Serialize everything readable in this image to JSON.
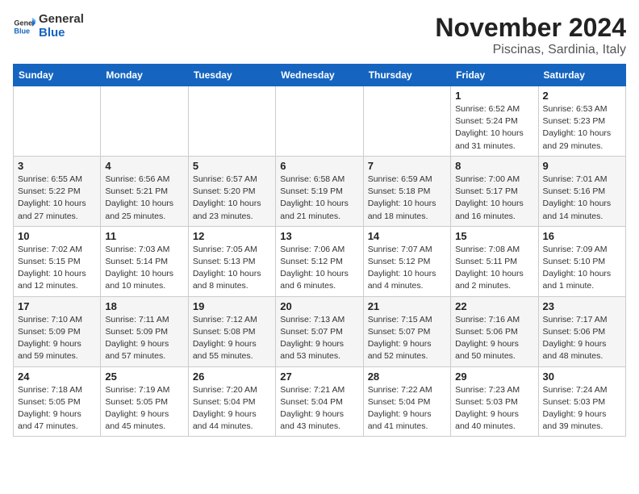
{
  "logo": {
    "general": "General",
    "blue": "Blue"
  },
  "header": {
    "month": "November 2024",
    "location": "Piscinas, Sardinia, Italy"
  },
  "weekdays": [
    "Sunday",
    "Monday",
    "Tuesday",
    "Wednesday",
    "Thursday",
    "Friday",
    "Saturday"
  ],
  "weeks": [
    [
      {
        "day": "",
        "detail": ""
      },
      {
        "day": "",
        "detail": ""
      },
      {
        "day": "",
        "detail": ""
      },
      {
        "day": "",
        "detail": ""
      },
      {
        "day": "",
        "detail": ""
      },
      {
        "day": "1",
        "detail": "Sunrise: 6:52 AM\nSunset: 5:24 PM\nDaylight: 10 hours and 31 minutes."
      },
      {
        "day": "2",
        "detail": "Sunrise: 6:53 AM\nSunset: 5:23 PM\nDaylight: 10 hours and 29 minutes."
      }
    ],
    [
      {
        "day": "3",
        "detail": "Sunrise: 6:55 AM\nSunset: 5:22 PM\nDaylight: 10 hours and 27 minutes."
      },
      {
        "day": "4",
        "detail": "Sunrise: 6:56 AM\nSunset: 5:21 PM\nDaylight: 10 hours and 25 minutes."
      },
      {
        "day": "5",
        "detail": "Sunrise: 6:57 AM\nSunset: 5:20 PM\nDaylight: 10 hours and 23 minutes."
      },
      {
        "day": "6",
        "detail": "Sunrise: 6:58 AM\nSunset: 5:19 PM\nDaylight: 10 hours and 21 minutes."
      },
      {
        "day": "7",
        "detail": "Sunrise: 6:59 AM\nSunset: 5:18 PM\nDaylight: 10 hours and 18 minutes."
      },
      {
        "day": "8",
        "detail": "Sunrise: 7:00 AM\nSunset: 5:17 PM\nDaylight: 10 hours and 16 minutes."
      },
      {
        "day": "9",
        "detail": "Sunrise: 7:01 AM\nSunset: 5:16 PM\nDaylight: 10 hours and 14 minutes."
      }
    ],
    [
      {
        "day": "10",
        "detail": "Sunrise: 7:02 AM\nSunset: 5:15 PM\nDaylight: 10 hours and 12 minutes."
      },
      {
        "day": "11",
        "detail": "Sunrise: 7:03 AM\nSunset: 5:14 PM\nDaylight: 10 hours and 10 minutes."
      },
      {
        "day": "12",
        "detail": "Sunrise: 7:05 AM\nSunset: 5:13 PM\nDaylight: 10 hours and 8 minutes."
      },
      {
        "day": "13",
        "detail": "Sunrise: 7:06 AM\nSunset: 5:12 PM\nDaylight: 10 hours and 6 minutes."
      },
      {
        "day": "14",
        "detail": "Sunrise: 7:07 AM\nSunset: 5:12 PM\nDaylight: 10 hours and 4 minutes."
      },
      {
        "day": "15",
        "detail": "Sunrise: 7:08 AM\nSunset: 5:11 PM\nDaylight: 10 hours and 2 minutes."
      },
      {
        "day": "16",
        "detail": "Sunrise: 7:09 AM\nSunset: 5:10 PM\nDaylight: 10 hours and 1 minute."
      }
    ],
    [
      {
        "day": "17",
        "detail": "Sunrise: 7:10 AM\nSunset: 5:09 PM\nDaylight: 9 hours and 59 minutes."
      },
      {
        "day": "18",
        "detail": "Sunrise: 7:11 AM\nSunset: 5:09 PM\nDaylight: 9 hours and 57 minutes."
      },
      {
        "day": "19",
        "detail": "Sunrise: 7:12 AM\nSunset: 5:08 PM\nDaylight: 9 hours and 55 minutes."
      },
      {
        "day": "20",
        "detail": "Sunrise: 7:13 AM\nSunset: 5:07 PM\nDaylight: 9 hours and 53 minutes."
      },
      {
        "day": "21",
        "detail": "Sunrise: 7:15 AM\nSunset: 5:07 PM\nDaylight: 9 hours and 52 minutes."
      },
      {
        "day": "22",
        "detail": "Sunrise: 7:16 AM\nSunset: 5:06 PM\nDaylight: 9 hours and 50 minutes."
      },
      {
        "day": "23",
        "detail": "Sunrise: 7:17 AM\nSunset: 5:06 PM\nDaylight: 9 hours and 48 minutes."
      }
    ],
    [
      {
        "day": "24",
        "detail": "Sunrise: 7:18 AM\nSunset: 5:05 PM\nDaylight: 9 hours and 47 minutes."
      },
      {
        "day": "25",
        "detail": "Sunrise: 7:19 AM\nSunset: 5:05 PM\nDaylight: 9 hours and 45 minutes."
      },
      {
        "day": "26",
        "detail": "Sunrise: 7:20 AM\nSunset: 5:04 PM\nDaylight: 9 hours and 44 minutes."
      },
      {
        "day": "27",
        "detail": "Sunrise: 7:21 AM\nSunset: 5:04 PM\nDaylight: 9 hours and 43 minutes."
      },
      {
        "day": "28",
        "detail": "Sunrise: 7:22 AM\nSunset: 5:04 PM\nDaylight: 9 hours and 41 minutes."
      },
      {
        "day": "29",
        "detail": "Sunrise: 7:23 AM\nSunset: 5:03 PM\nDaylight: 9 hours and 40 minutes."
      },
      {
        "day": "30",
        "detail": "Sunrise: 7:24 AM\nSunset: 5:03 PM\nDaylight: 9 hours and 39 minutes."
      }
    ]
  ]
}
